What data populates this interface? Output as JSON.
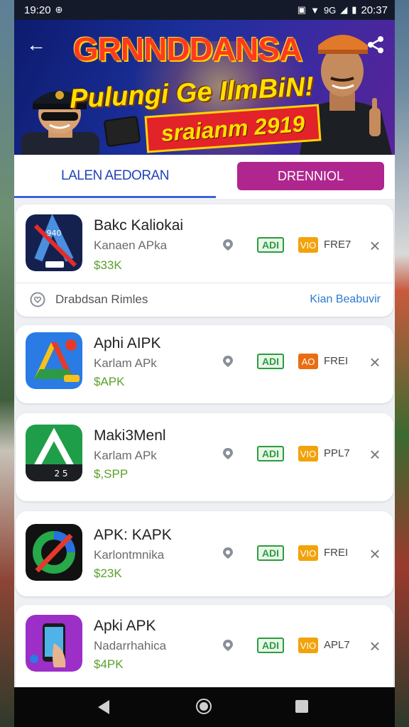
{
  "status_bar": {
    "time": "19:20",
    "right_time": "20:37",
    "net_label": "9G"
  },
  "banner": {
    "title_line1": "GRNNDDANSA",
    "title_line2": "Pulungi Ge IlmBiN!",
    "title_line3": "sraianm 2919"
  },
  "tabs": {
    "left_label": "LALEN AEDORAN",
    "right_label": "DRENNIOL"
  },
  "apps": [
    {
      "name": "Bakc Kaliokai",
      "subtitle": "Kanaen APka",
      "price": "$33K",
      "tag_apd": "ADI",
      "tag_vo": "VIO",
      "tag_text": "FRE7",
      "icon": "blue-app-icon"
    },
    {
      "name": "Aphi AIPK",
      "subtitle": "Karlam APk",
      "price": "$APK",
      "tag_apd": "ADI",
      "tag_vo": "AO",
      "tag_text": "FREI",
      "icon": "drive-app-icon"
    },
    {
      "name": "Maki3Menl",
      "subtitle": "Karlam APk",
      "price": "$,SPP",
      "tag_apd": "ADI",
      "tag_vo": "VIO",
      "tag_text": "PPL7",
      "icon": "green-app-icon"
    },
    {
      "name": "APK: KAPK",
      "subtitle": "Karlontmnika",
      "price": "$23K",
      "tag_apd": "ADI",
      "tag_vo": "VIO",
      "tag_text": "FREI",
      "icon": "ring-app-icon"
    },
    {
      "name": "Apki APK",
      "subtitle": "Nadarrhahica",
      "price": "$4PK",
      "tag_apd": "ADI",
      "tag_vo": "VIO",
      "tag_text": "APL7",
      "icon": "purple-app-icon"
    }
  ],
  "sub_row": {
    "label": "Drabdsan Rimles",
    "link": "Kian Beabuvir"
  },
  "colors": {
    "accent_blue": "#2243b8",
    "tab_magenta": "#b0268f",
    "price_green": "#5aa02c",
    "tag_green": "#2b9c3e",
    "tag_orange": "#f2a20b"
  }
}
